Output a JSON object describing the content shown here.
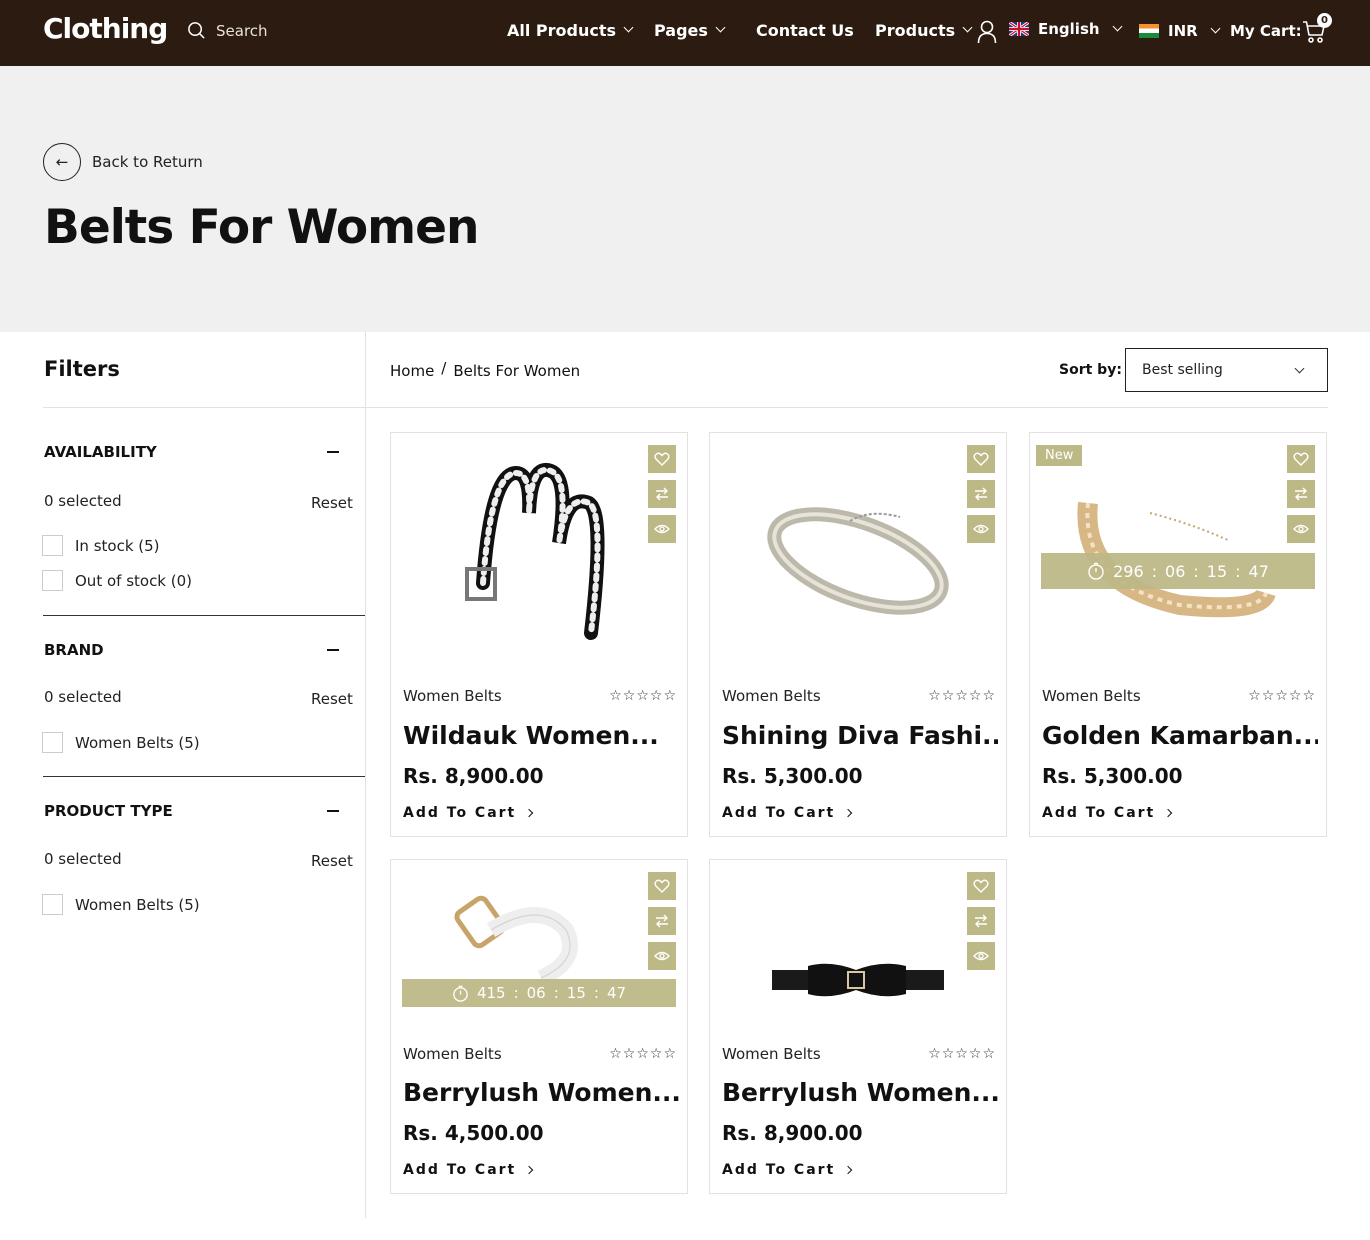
{
  "header": {
    "logo": "Clothing",
    "search_placeholder": "Search",
    "nav": {
      "all_products": "All Products",
      "pages": "Pages",
      "contact": "Contact Us",
      "products": "Products",
      "language": "English",
      "currency": "INR",
      "cart_label": "My Cart:",
      "cart_count": "0"
    }
  },
  "hero": {
    "back_label": "Back to Return",
    "title": "Belts For Women"
  },
  "filters": {
    "title": "Filters",
    "sections": [
      {
        "title": "AVAILABILITY",
        "selected": "0 selected",
        "reset": "Reset",
        "options": [
          "In stock (5)",
          "Out of stock (0)"
        ]
      },
      {
        "title": "BRAND",
        "selected": "0 selected",
        "reset": "Reset",
        "options": [
          "Women Belts (5)"
        ]
      },
      {
        "title": "PRODUCT TYPE",
        "selected": "0 selected",
        "reset": "Reset",
        "options": [
          "Women Belts (5)"
        ]
      }
    ]
  },
  "toolbar": {
    "breadcrumb_home": "Home",
    "breadcrumb_sep": "/",
    "breadcrumb_current": "Belts For Women",
    "sort_label": "Sort by:",
    "sort_value": "Best selling"
  },
  "products": [
    {
      "category": "Women Belts",
      "name": "Wildauk Women...",
      "price": "Rs. 8,900.00",
      "cta": "Add To Cart",
      "stars": "☆☆☆☆☆"
    },
    {
      "category": "Women Belts",
      "name": "Shining Diva Fashi...",
      "price": "Rs. 5,300.00",
      "cta": "Add To Cart",
      "stars": "☆☆☆☆☆"
    },
    {
      "category": "Women Belts",
      "name": "Golden Kamarban...",
      "price": "Rs. 5,300.00",
      "cta": "Add To Cart",
      "stars": "☆☆☆☆☆",
      "badge": "New",
      "timer": [
        "296",
        ":",
        "06",
        ":",
        "15",
        ":",
        "47"
      ]
    },
    {
      "category": "Women Belts",
      "name": "Berrylush Women...",
      "price": "Rs. 4,500.00",
      "cta": "Add To Cart",
      "stars": "☆☆☆☆☆",
      "timer": [
        "415",
        ":",
        "06",
        ":",
        "15",
        ":",
        "47"
      ]
    },
    {
      "category": "Women Belts",
      "name": "Berrylush Women...",
      "price": "Rs. 8,900.00",
      "cta": "Add To Cart",
      "stars": "☆☆☆☆☆"
    }
  ],
  "colors": {
    "header_bg": "#2b1b10",
    "accent": "#bdb987",
    "hero_bg": "#f0f0f0"
  }
}
